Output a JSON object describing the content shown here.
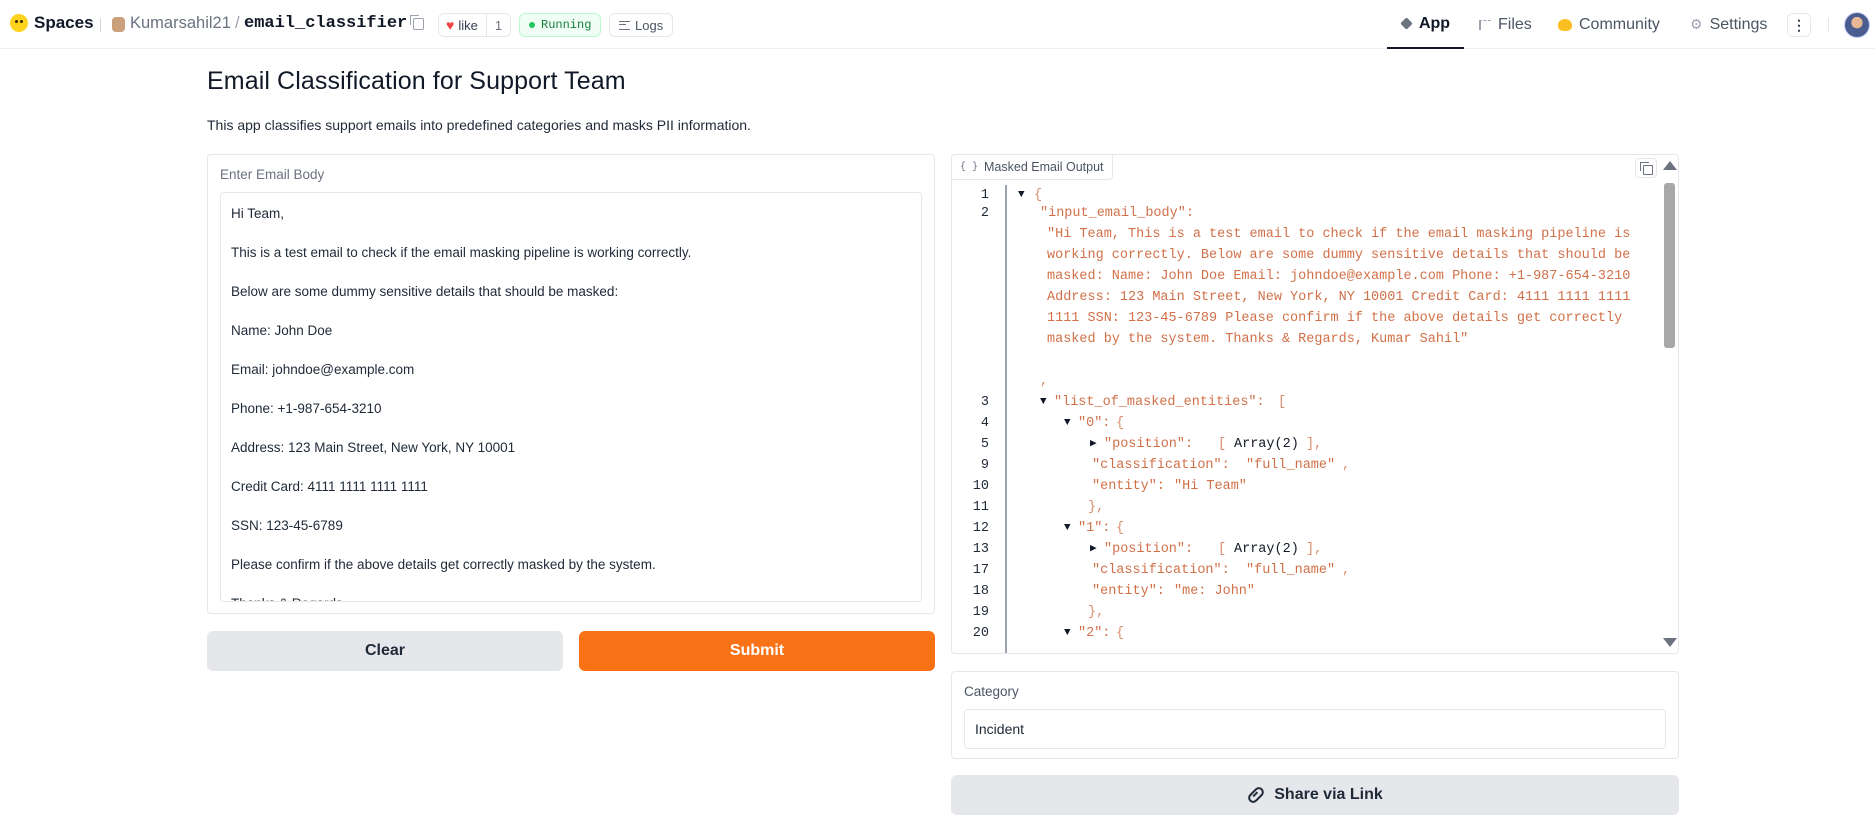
{
  "topbar": {
    "spaces_label": "Spaces",
    "owner": "Kumarsahil21",
    "separator": "/",
    "repo": "email_classifier",
    "like_label": "like",
    "like_count": "1",
    "status": "Running",
    "logs_label": "Logs",
    "tabs": [
      {
        "label": "App",
        "icon": "cube-icon",
        "active": true
      },
      {
        "label": "Files",
        "icon": "files-icon",
        "active": false
      },
      {
        "label": "Community",
        "icon": "community-icon",
        "active": false
      },
      {
        "label": "Settings",
        "icon": "gear-icon",
        "active": false
      }
    ],
    "menu_glyph": "⋮"
  },
  "app": {
    "title": "Email Classification for Support Team",
    "description": "This app classifies support emails into predefined categories and masks PII information."
  },
  "input": {
    "label": "Enter Email Body",
    "lines": [
      "Hi Team,",
      "This is a test email to check if the email masking pipeline is working correctly.",
      "Below are some dummy sensitive details that should be masked:",
      "Name: John Doe",
      "Email: johndoe@example.com",
      "Phone: +1-987-654-3210",
      "Address: 123 Main Street, New York, NY 10001",
      "Credit Card: 4111 1111 1111 1111",
      "SSN: 123-45-6789",
      "Please confirm if the above details get correctly masked by the system.",
      "Thanks & Regards,"
    ]
  },
  "buttons": {
    "clear": "Clear",
    "submit": "Submit",
    "share": "Share via Link"
  },
  "output": {
    "label": "Masked Email Output",
    "json": {
      "line_numbers": [
        "1",
        "2",
        "3",
        "4",
        "5",
        "9",
        "10",
        "11",
        "12",
        "13",
        "17",
        "18",
        "19",
        "20"
      ],
      "input_key": "\"input_email_body\":",
      "input_value": "\"Hi Team, This is a test email to check if the email masking pipeline is working correctly. Below are some dummy sensitive details that should be masked: Name: John Doe Email: johndoe@example.com Phone: +1-987-654-3210 Address: 123 Main Street, New York, NY 10001 Credit Card: 4111 1111 1111 1111 SSN: 123-45-6789 Please confirm if the above details get correctly masked by the system. Thanks & Regards, Kumar Sahil\"",
      "list_key": "\"list_of_masked_entities\":",
      "entities": [
        {
          "index": "\"0\":",
          "position": "Array(2)",
          "classification": "\"full_name\"",
          "entity": "\"Hi Team\""
        },
        {
          "index": "\"1\":",
          "position": "Array(2)",
          "classification": "\"full_name\"",
          "entity": "\"me: John\""
        },
        {
          "index": "\"2\":"
        }
      ],
      "position_key": "\"position\":",
      "classification_key": "\"classification\":",
      "entity_key": "\"entity\":"
    }
  },
  "category": {
    "label": "Category",
    "value": "Incident"
  }
}
